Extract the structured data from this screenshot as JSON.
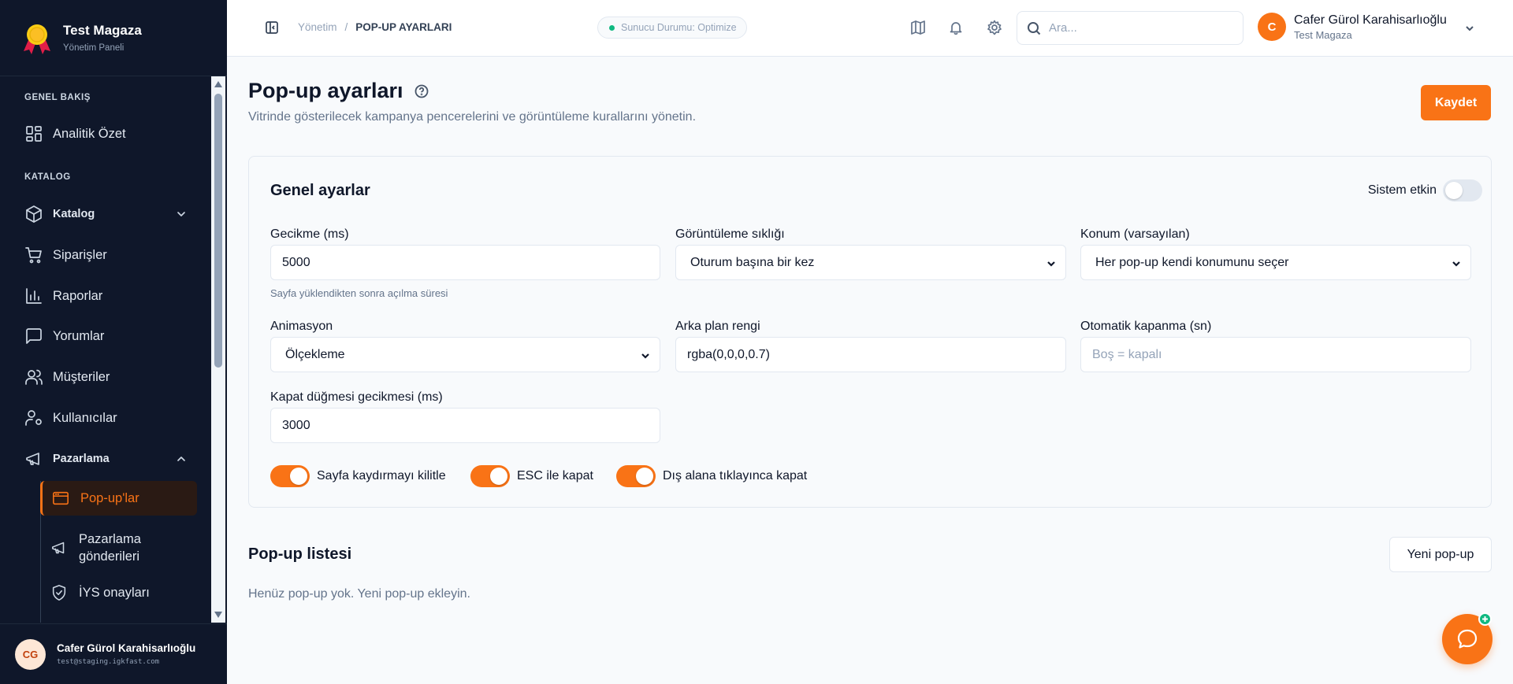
{
  "brand": {
    "title": "Test Magaza",
    "subtitle": "Yönetim Paneli"
  },
  "sidebar": {
    "sections": {
      "overview": "GENEL BAKIŞ",
      "catalog": "KATALOG"
    },
    "items": {
      "analytics": "Analitik Özet",
      "catalog": "Katalog",
      "orders": "Siparişler",
      "reports": "Raporlar",
      "reviews": "Yorumlar",
      "customers": "Müşteriler",
      "users": "Kullanıcılar",
      "marketing": "Pazarlama"
    },
    "subitems": {
      "popups": "Pop-up'lar",
      "marketing_sends": "Pazarlama gönderileri",
      "iys": "İYS onayları"
    },
    "user": {
      "initials": "CG",
      "name": "Cafer Gürol Karahisarlıoğlu",
      "email": "test@staging.igkfast.com"
    }
  },
  "header": {
    "breadcrumb": {
      "root": "Yönetim",
      "separator": "/",
      "current": "POP-UP AYARLARI"
    },
    "server_status": "Sunucu Durumu: Optimize",
    "search_placeholder": "Ara...",
    "user": {
      "initial": "C",
      "name": "Cafer Gürol Karahisarlıoğlu",
      "store": "Test Magaza"
    }
  },
  "page": {
    "title": "Pop-up ayarları",
    "subtitle": "Vitrinde gösterilecek kampanya pencerelerini ve görüntüleme kurallarını yönetin.",
    "save_label": "Kaydet"
  },
  "general": {
    "title": "Genel ayarlar",
    "system_enabled_label": "Sistem etkin",
    "system_enabled": false,
    "delay_label": "Gecikme (ms)",
    "delay_value": "5000",
    "delay_hint": "Sayfa yüklendikten sonra açılma süresi",
    "frequency_label": "Görüntüleme sıklığı",
    "frequency_value": "Oturum başına bir kez",
    "position_label": "Konum (varsayılan)",
    "position_value": "Her pop-up kendi konumunu seçer",
    "animation_label": "Animasyon",
    "animation_value": "Ölçekleme",
    "bg_color_label": "Arka plan rengi",
    "bg_color_value": "rgba(0,0,0,0.7)",
    "auto_close_label": "Otomatik kapanma (sn)",
    "auto_close_placeholder": "Boş = kapalı",
    "close_delay_label": "Kapat düğmesi gecikmesi (ms)",
    "close_delay_value": "3000",
    "toggles": {
      "lock_scroll": {
        "label": "Sayfa kaydırmayı kilitle",
        "on": true
      },
      "esc_close": {
        "label": "ESC ile kapat",
        "on": true
      },
      "outside_close": {
        "label": "Dış alana tıklayınca kapat",
        "on": true
      }
    }
  },
  "list": {
    "title": "Pop-up listesi",
    "new_label": "Yeni pop-up",
    "empty_text": "Henüz pop-up yok. Yeni pop-up ekleyin."
  },
  "colors": {
    "accent": "#f97316",
    "sidebar_bg": "#0f172a",
    "status_dot": "#10b981"
  }
}
